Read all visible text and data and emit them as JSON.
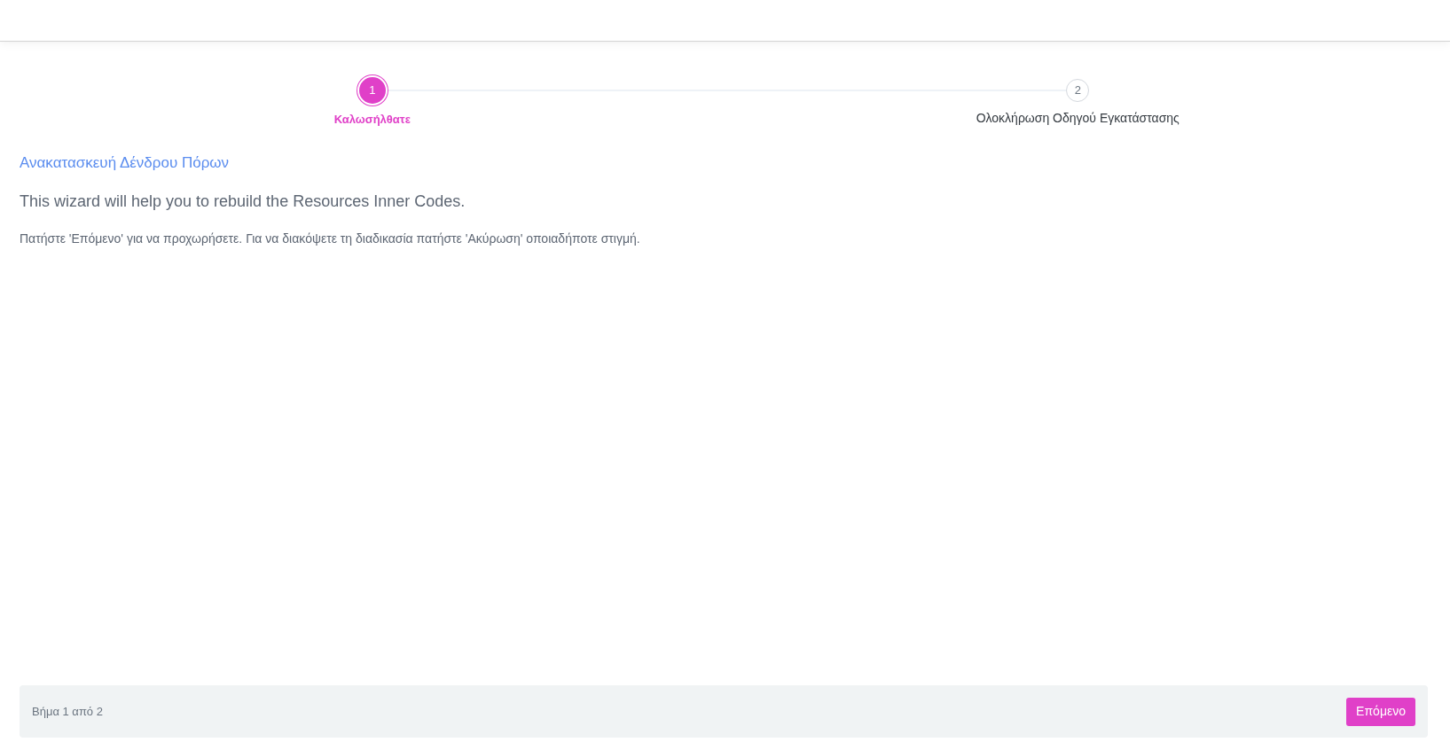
{
  "steps": [
    {
      "number": "1",
      "label": "Καλωσήλθατε",
      "selected": true
    },
    {
      "number": "2",
      "label": "Ολοκλήρωση Οδηγού Εγκατάστασης",
      "selected": false
    }
  ],
  "title": "Ανακατασκευή Δένδρου Πόρων",
  "subtitle": "This wizard will help you to rebuild the Resources Inner Codes.",
  "instructions": "Πατήστε 'Επόμενο' για να προχωρήσετε. Για να διακόψετε τη διαδικασία πατήστε 'Ακύρωση' οποιαδήποτε στιγμή.",
  "footer": {
    "step_counter": "Βήμα 1 από 2",
    "next_button": "Επόμενο"
  }
}
